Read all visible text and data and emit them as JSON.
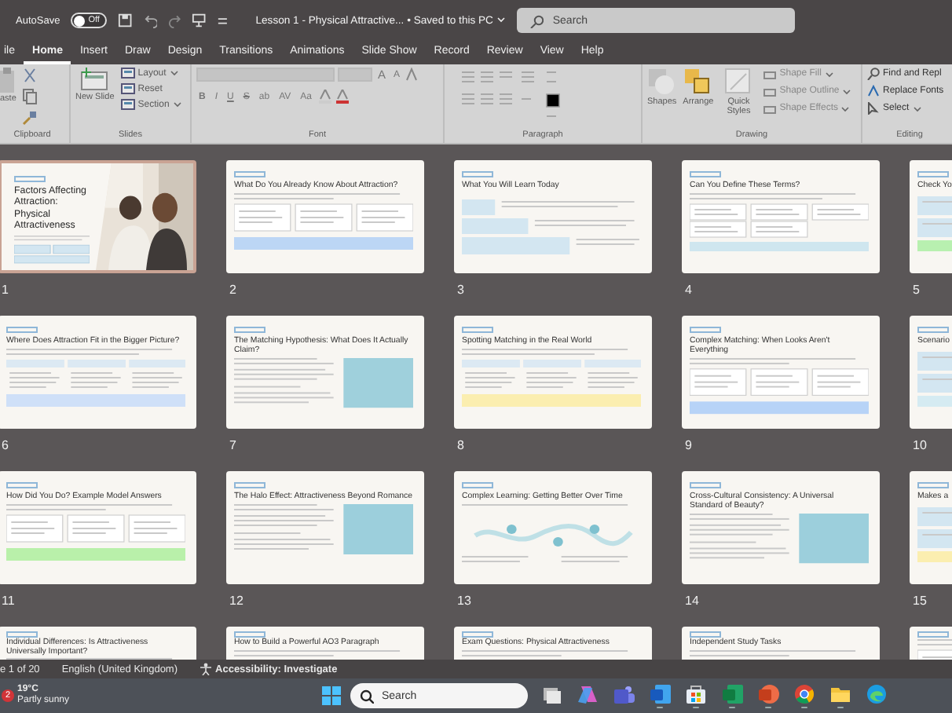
{
  "title_bar": {
    "autosave_label": "AutoSave",
    "autosave": {
      "on": false,
      "label": "Off"
    },
    "document_title": "Lesson 1 - Physical Attractive...",
    "save_status": "• Saved to this PC",
    "search": {
      "placeholder": "Search"
    }
  },
  "tabs": [
    {
      "label": "ile",
      "selected": false
    },
    {
      "label": "Home",
      "selected": true
    },
    {
      "label": "Insert",
      "selected": false
    },
    {
      "label": "Draw",
      "selected": false
    },
    {
      "label": "Design",
      "selected": false
    },
    {
      "label": "Transitions",
      "selected": false
    },
    {
      "label": "Animations",
      "selected": false
    },
    {
      "label": "Slide Show",
      "selected": false
    },
    {
      "label": "Record",
      "selected": false
    },
    {
      "label": "Review",
      "selected": false
    },
    {
      "label": "View",
      "selected": false
    },
    {
      "label": "Help",
      "selected": false
    }
  ],
  "ribbon": {
    "clipboard": {
      "paste": "aste",
      "label": "Clipboard"
    },
    "slides": {
      "new_slide": "New Slide",
      "items": [
        "Layout",
        "Reset",
        "Section"
      ],
      "label": "Slides"
    },
    "font": {
      "size_buttons": [
        "A",
        "A"
      ],
      "format_buttons": [
        "B",
        "I",
        "U",
        "S",
        "ab",
        "AV",
        "Aa"
      ],
      "label": "Font"
    },
    "paragraph": {
      "label": "Paragraph"
    },
    "drawing": {
      "shapes": "Shapes",
      "arrange": "Arrange",
      "quick_styles": "Quick Styles",
      "items": [
        "Shape Fill",
        "Shape Outline",
        "Shape Effects"
      ],
      "label": "Drawing"
    },
    "editing": {
      "items": [
        "Find and Repl",
        "Replace Fonts",
        "Select"
      ],
      "label": "Editing"
    }
  },
  "slides": [
    {
      "number": "1",
      "title": "Factors Affecting Attraction: Physical Attractiveness",
      "kind": "hero",
      "selected": true
    },
    {
      "number": "2",
      "title": "What Do You Already Know About Attraction?",
      "kind": "cards",
      "selected": false,
      "color": "#bcd6f5"
    },
    {
      "number": "3",
      "title": "What You Will Learn Today",
      "kind": "steps",
      "selected": false
    },
    {
      "number": "4",
      "title": "Can You Define These Terms?",
      "kind": "grid",
      "selected": false,
      "color": "#cfe6ef"
    },
    {
      "number": "5",
      "title": "Check Yo",
      "kind": "checklist",
      "selected": false,
      "color": "#b8f0b0"
    },
    {
      "number": "6",
      "title": "Where Does Attraction Fit in the Bigger Picture?",
      "kind": "columns",
      "selected": false,
      "color": "#cfe0f8"
    },
    {
      "number": "7",
      "title": "The Matching Hypothesis: What Does It Actually Claim?",
      "kind": "split",
      "selected": false,
      "color": "#9fd0dc"
    },
    {
      "number": "8",
      "title": "Spotting Matching in the Real World",
      "kind": "columns",
      "selected": false,
      "color": "#fbeeb0"
    },
    {
      "number": "9",
      "title": "Complex Matching: When Looks Aren't Everything",
      "kind": "cards",
      "selected": false,
      "color": "#b7d3f7"
    },
    {
      "number": "10",
      "title": "Scenario",
      "kind": "checklist",
      "selected": false,
      "color": "#d5ebf2"
    },
    {
      "number": "11",
      "title": "How Did You Do? Example Model Answers",
      "kind": "cards",
      "selected": false,
      "color": "#b9f0aa"
    },
    {
      "number": "12",
      "title": "The Halo Effect: Attractiveness Beyond Romance",
      "kind": "split",
      "selected": false,
      "color": "#9ccfdc"
    },
    {
      "number": "13",
      "title": "Complex Learning: Getting Better Over Time",
      "kind": "wave",
      "selected": false
    },
    {
      "number": "14",
      "title": "Cross-Cultural Consistency: A Universal Standard of Beauty?",
      "kind": "split",
      "selected": false,
      "color": "#9ccfdc"
    },
    {
      "number": "15",
      "title": "Makes a",
      "kind": "checklist",
      "selected": false,
      "color": "#fbeeb0"
    },
    {
      "title": "Individual Differences: Is Attractiveness Universally Important?",
      "kind": "cards",
      "selected": false
    },
    {
      "title": "How to Build a Powerful AO3 Paragraph",
      "kind": "cards",
      "selected": false
    },
    {
      "title": "Exam Questions: Physical Attractiveness",
      "kind": "cards",
      "selected": false
    },
    {
      "title": "Independent Study Tasks",
      "kind": "cards",
      "selected": false
    },
    {
      "kind": "cards",
      "selected": false
    }
  ],
  "status_bar": {
    "slide_counter": "e 1 of 20",
    "language": "English (United Kingdom)",
    "accessibility": "Accessibility: Investigate"
  },
  "taskbar": {
    "weather": {
      "badge": "2",
      "temperature": "19°C",
      "condition": "Partly sunny"
    },
    "search": {
      "placeholder": "Search"
    },
    "apps": [
      {
        "kind": "task-view",
        "running": false
      },
      {
        "kind": "copilot",
        "running": false
      },
      {
        "kind": "teams",
        "running": false
      },
      {
        "kind": "word",
        "running": true
      },
      {
        "kind": "store",
        "running": true
      },
      {
        "kind": "excel",
        "running": true
      },
      {
        "kind": "powerpoint",
        "running": true
      },
      {
        "kind": "chrome",
        "running": true
      },
      {
        "kind": "explorer",
        "running": true
      },
      {
        "kind": "edge",
        "running": false
      }
    ]
  }
}
